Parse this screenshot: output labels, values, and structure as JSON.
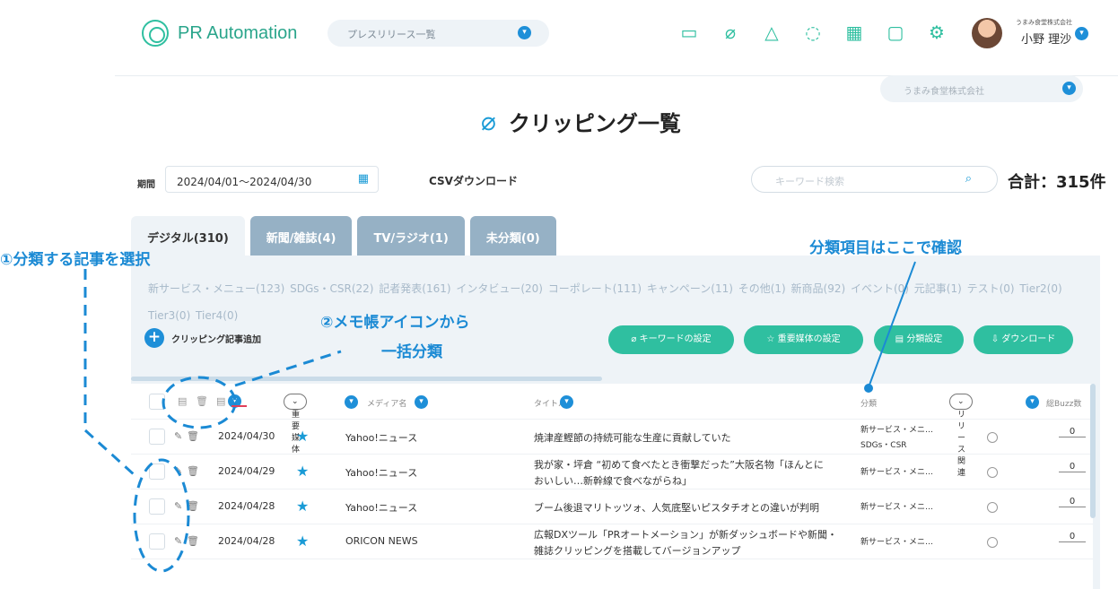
{
  "header": {
    "app_name": "PR Automation",
    "page_select": "プレスリリース一覧",
    "company_small": "うまみ食堂株式会社",
    "user_name": "小野 理沙",
    "icons": [
      "chat-icon",
      "clip-icon",
      "bell-icon",
      "bulb-icon",
      "calendar-icon",
      "person-icon",
      "gear-icon"
    ]
  },
  "company_select": "うまみ食堂株式会社",
  "page_title": "クリッピング一覧",
  "filters": {
    "period_label": "期間",
    "period_value": "2024/04/01〜2024/04/30",
    "csv_label": "CSVダウンロード",
    "search_placeholder": "キーワード検索",
    "total": "合計：315件"
  },
  "tabs": [
    "デジタル(310)",
    "新聞/雑誌(4)",
    "TV/ラジオ(1)",
    "未分類(0)"
  ],
  "categories": "新サービス・メニュー(123)  SDGs・CSR(22)  記者発表(161)  インタビュー(20)  コーポレート(111)  キャンペーン(11)  その他(1)  新商品(92)  イベント(0)  元記事(1)  テスト(0)  Tier2(0)  Tier3(0)  Tier4(0)",
  "actions": {
    "add_clipping": "クリッピング記事追加",
    "keyword_settings": "キーワードの設定",
    "important_media_settings": "☆ 重要媒体の設定",
    "category_settings": "分類設定",
    "download": "ダウンロード"
  },
  "table": {
    "headers": {
      "important_media": "重要媒体",
      "media_name": "メディア名",
      "title": "タイトル",
      "category": "分類",
      "release_related": "リリース関連",
      "total_buzz": "総Buzz数"
    },
    "rows": [
      {
        "date": "2024/04/30",
        "media": "Yahoo!ニュース",
        "title1": "焼津産鰹節の持続可能な生産に貢献していた",
        "title2": "",
        "cat1": "新サービス・メニ…",
        "cat2": "SDGs・CSR",
        "buzz": "0"
      },
      {
        "date": "2024/04/29",
        "media": "Yahoo!ニュース",
        "title1": "我が家・坪倉 “初めて食べたとき衝撃だった”大阪名物「ほんとに",
        "title2": "おいしい…新幹線で食べながらね」",
        "cat1": "新サービス・メニ…",
        "cat2": "",
        "buzz": "0"
      },
      {
        "date": "2024/04/28",
        "media": "Yahoo!ニュース",
        "title1": "ブーム後退マリトッツォ、人気底堅いピスタチオとの違いが判明",
        "title2": "",
        "cat1": "新サービス・メニ…",
        "cat2": "",
        "buzz": "0"
      },
      {
        "date": "2024/04/28",
        "media": "ORICON NEWS",
        "title1": "広報DXツール「PRオートメーション」が新ダッシュボードや新聞・",
        "title2": "雑誌クリッピングを搭載してバージョンアップ",
        "cat1": "新サービス・メニ…",
        "cat2": "",
        "buzz": "0"
      }
    ]
  },
  "annotations": {
    "step1": "①分類する記事を選択",
    "step2_line1": "②メモ帳アイコンから",
    "step2_line2": "一括分類",
    "category_note": "分類項目はここで確認"
  },
  "colors": {
    "accent_green": "#2fbfa0",
    "accent_blue": "#1e8fd8",
    "annotation_blue": "#1b8ad4"
  }
}
